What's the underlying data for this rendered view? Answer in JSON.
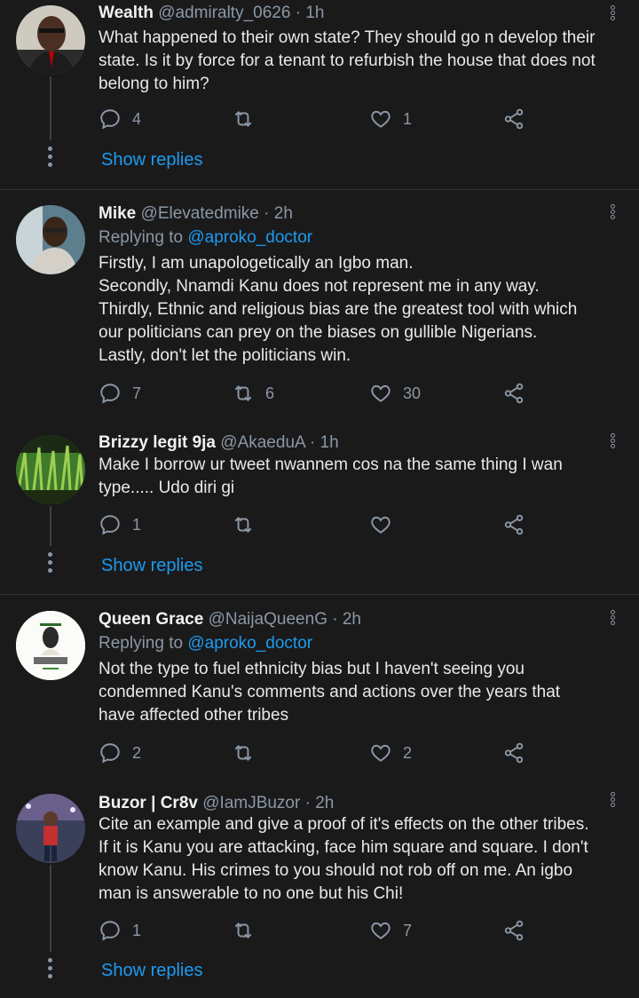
{
  "colors": {
    "background": "#1a1a1b",
    "accent": "#1d9bf0",
    "muted": "#8b98a5"
  },
  "tweets": [
    {
      "name": "Wealth",
      "handle": "@admiralty_0626 · 1h",
      "lines": [
        "What happened to their own state? They should go n develop their",
        "state. Is it by force for a tenant to refurbish the house that does not",
        "belong to him?"
      ],
      "replies": "4",
      "retweets": "",
      "likes": "1",
      "show_replies": "Show replies"
    },
    {
      "name": "Mike",
      "handle": "@Elevatedmike · 2h",
      "replying_prefix": "Replying to ",
      "replying_to": "@aproko_doctor",
      "lines": [
        "Firstly, I am unapologetically an Igbo man.",
        "Secondly, Nnamdi Kanu does not represent me in any way.",
        "Thirdly, Ethnic and religious bias are the greatest tool with which",
        "our politicians can prey on the biases on gullible Nigerians.",
        "Lastly, don't let the politicians win."
      ],
      "replies": "7",
      "retweets": "6",
      "likes": "30"
    },
    {
      "name": "Brizzy legit 9ja",
      "handle": "@AkaeduA · 1h",
      "lines": [
        "Make I borrow ur tweet nwannem cos na the same thing I wan",
        "type..... Udo diri gi"
      ],
      "replies": "1",
      "retweets": "",
      "likes": "",
      "show_replies": "Show replies"
    },
    {
      "name": "Queen Grace",
      "handle": "@NaijaQueenG · 2h",
      "replying_prefix": "Replying to ",
      "replying_to": "@aproko_doctor",
      "lines": [
        "Not the type to fuel ethnicity bias but I haven't seeing you",
        "condemned Kanu's comments and actions over the years that",
        "have affected other tribes"
      ],
      "replies": "2",
      "retweets": "",
      "likes": "2"
    },
    {
      "name": "Buzor | Cr8v",
      "handle": "@IamJBuzor · 2h",
      "lines": [
        "Cite an example and give a proof of it's effects on the other tribes.",
        "If it is Kanu you are attacking, face him square and square. I don't",
        "know Kanu. His crimes to you should not rob off on me. An igbo",
        "man is answerable to no one but his Chi!"
      ],
      "replies": "1",
      "retweets": "",
      "likes": "7",
      "show_replies": "Show replies"
    }
  ]
}
